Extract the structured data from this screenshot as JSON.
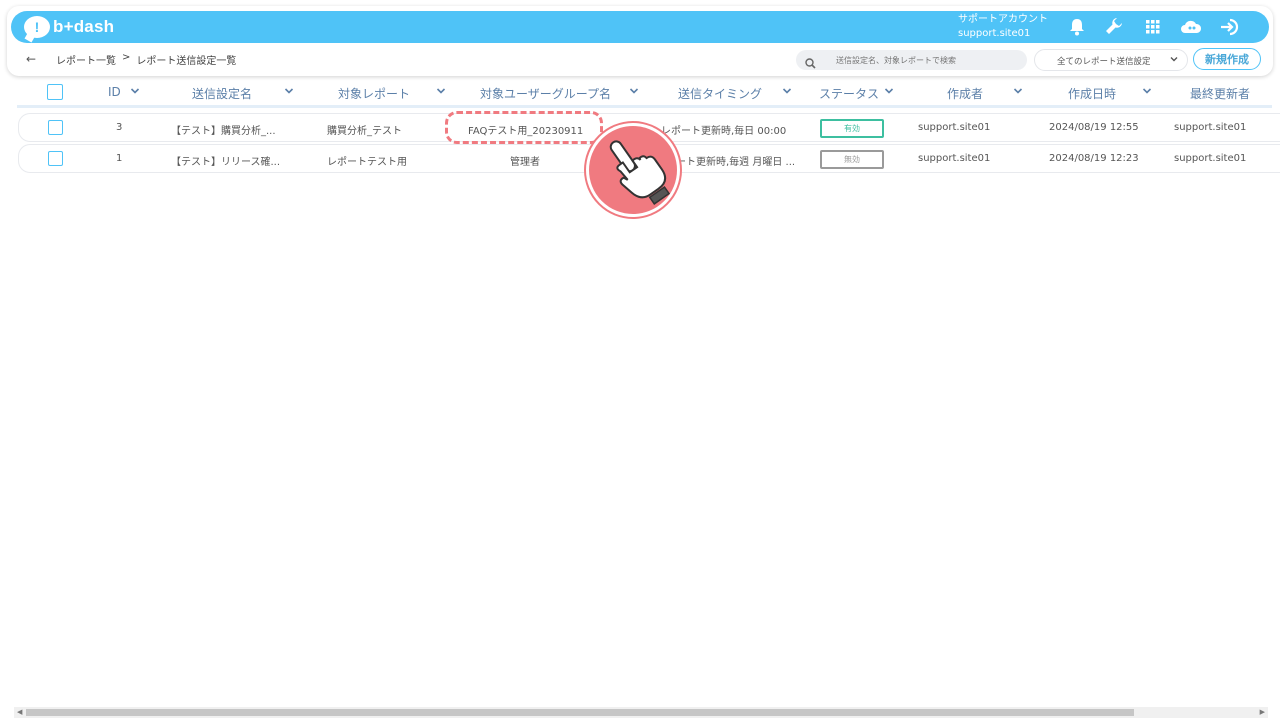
{
  "app": {
    "logo_text": "b+dash",
    "logo_mark": "!",
    "account_label": "サポートアカウント",
    "account_name": "support.site01",
    "accent_color": "#4fc3f7",
    "icons": [
      "bell-icon",
      "wrench-icon",
      "grid-icon",
      "cloud-icon",
      "logout-icon"
    ]
  },
  "breadcrumb": {
    "back": "←",
    "items": [
      "レポート一覧",
      ">",
      "レポート送信設定一覧"
    ]
  },
  "toolbar": {
    "search_placeholder": "送信設定名、対象レポートで検索",
    "filter_value": "全てのレポート送信設定",
    "new_button": "新規作成"
  },
  "table": {
    "headers": {
      "id": "ID",
      "name": "送信設定名",
      "report": "対象レポート",
      "group": "対象ユーザーグループ名",
      "timing": "送信タイミング",
      "status": "ステータス",
      "creator": "作成者",
      "created_at": "作成日時",
      "updater": "最終更新者"
    },
    "rows": [
      {
        "id": "3",
        "name": "【テスト】購買分析_...",
        "report": "購買分析_テスト",
        "group": "FAQテスト用_20230911",
        "timing": "レポート更新時,毎日 00:00",
        "status": "有効",
        "creator": "support.site01",
        "created_at": "2024/08/19 12:55",
        "updater": "support.site01"
      },
      {
        "id": "1",
        "name": "【テスト】リリース確...",
        "report": "レポートテスト用",
        "group": "管理者",
        "timing": "ート更新時,毎週 月曜日 ...",
        "status": "無効",
        "creator": "support.site01",
        "created_at": "2024/08/19 12:23",
        "updater": "support.site01"
      }
    ]
  }
}
